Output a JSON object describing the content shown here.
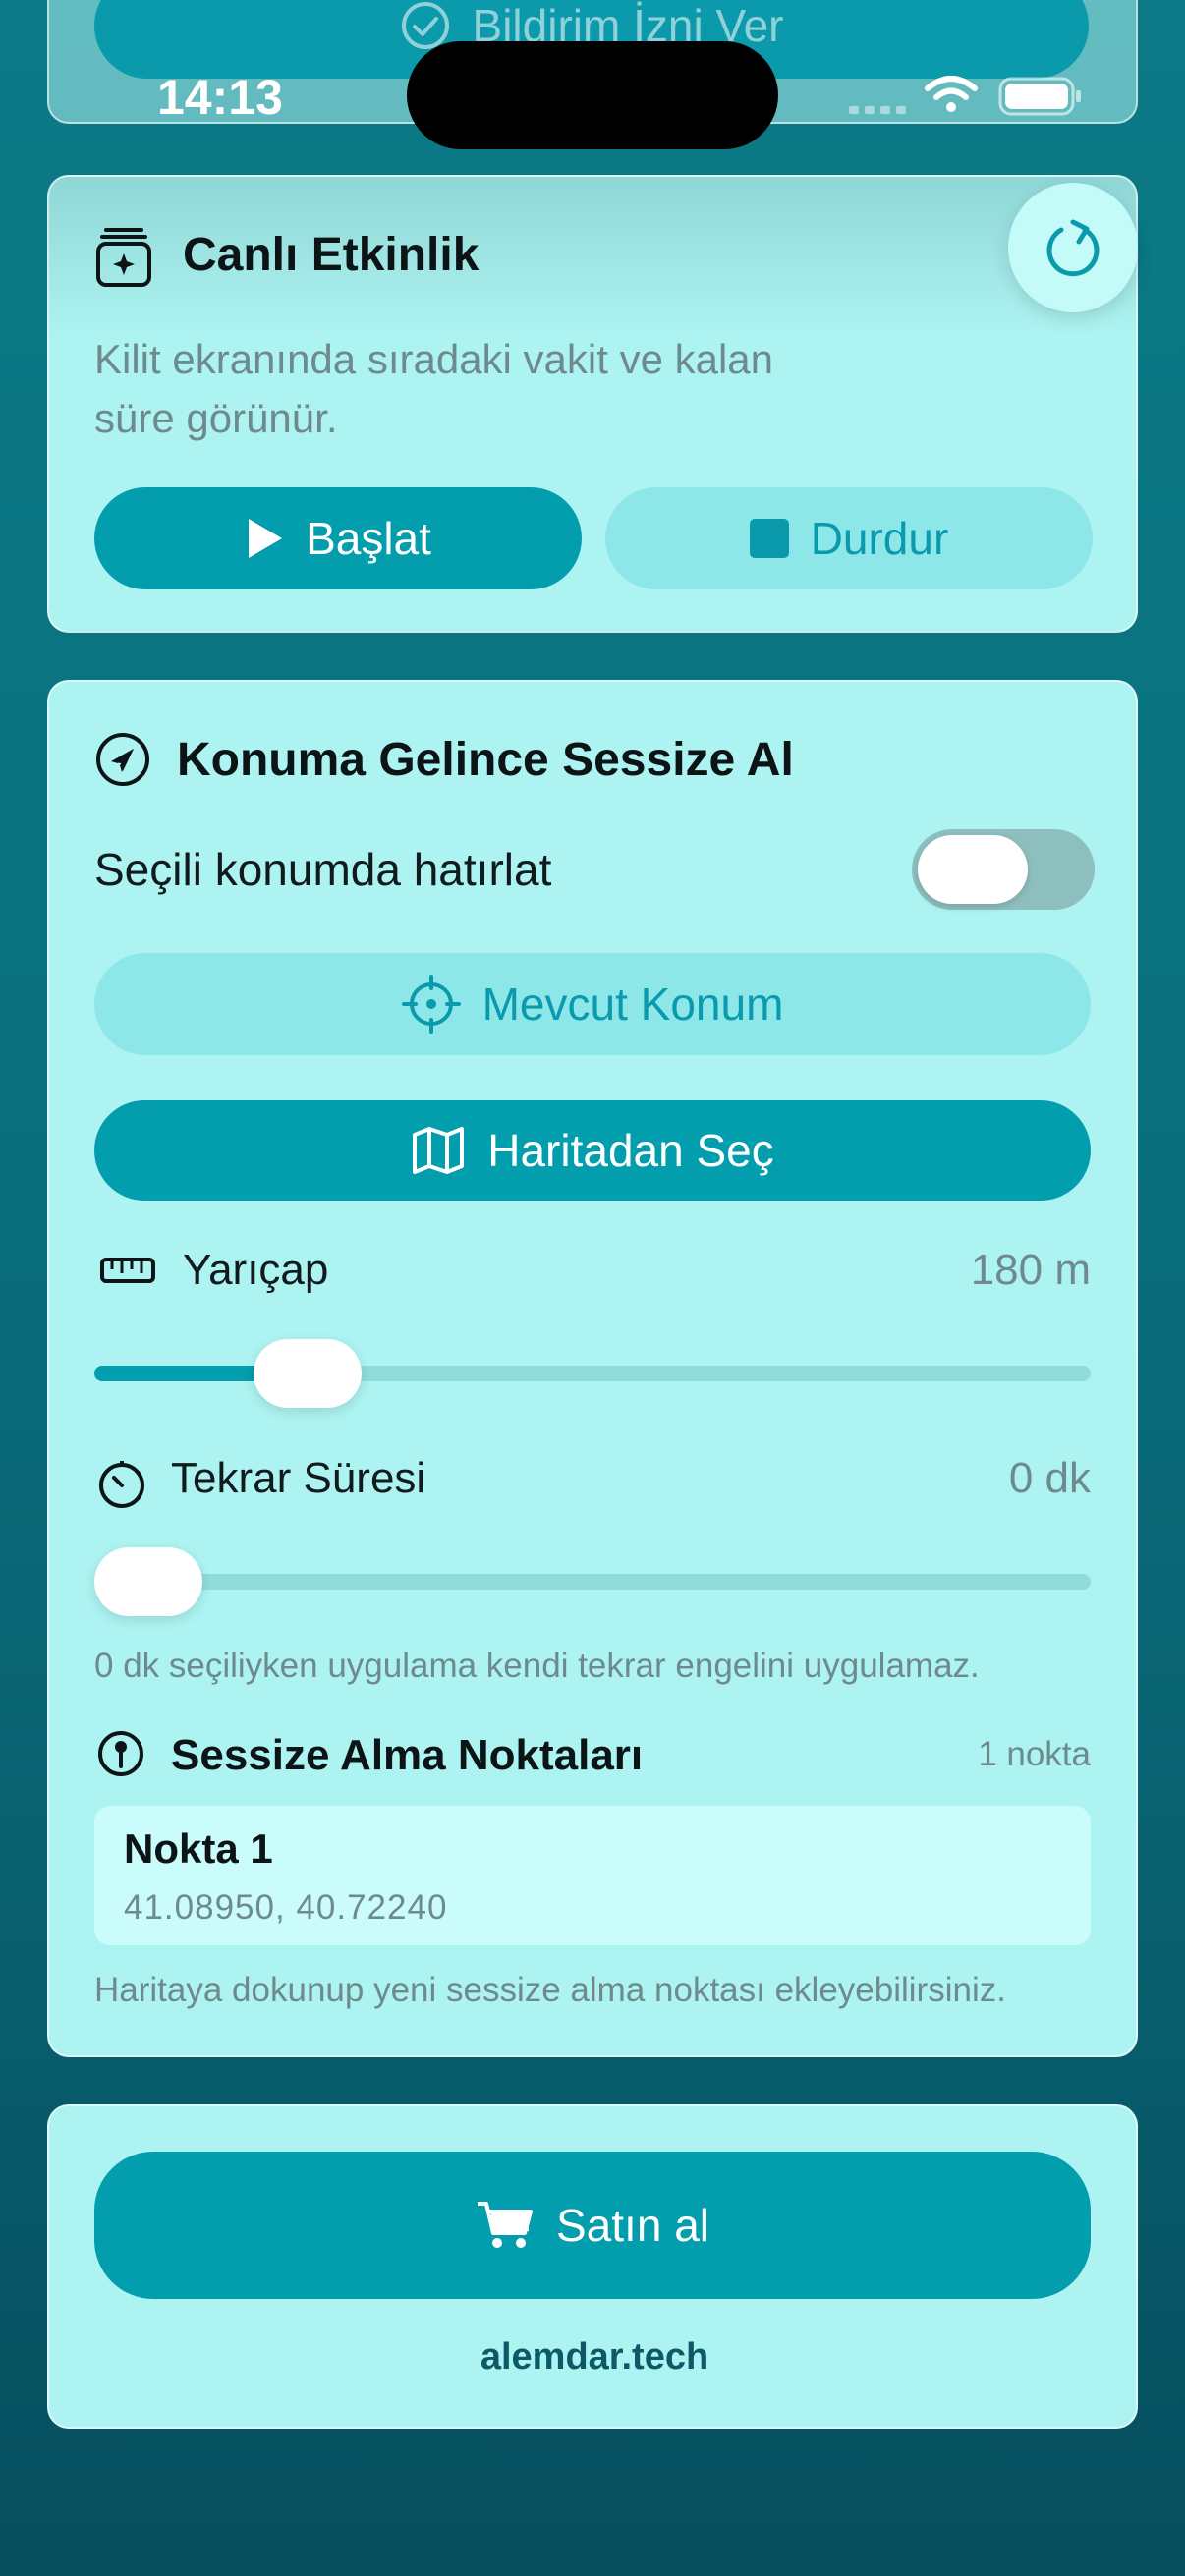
{
  "status_bar": {
    "time": "14:13"
  },
  "top_card": {
    "button_label": "Bildirim İzni Ver"
  },
  "live_activity": {
    "title": "Canlı Etkinlik",
    "description_line1": "Kilit ekranında sıradaki vakit ve kalan",
    "description_line2": "süre görünür.",
    "start_label": "Başlat",
    "stop_label": "Durdur"
  },
  "location_mute": {
    "title": "Konuma Gelince Sessize Al",
    "toggle_label": "Seçili konumda hatırlat",
    "toggle_on": false,
    "current_location_label": "Mevcut Konum",
    "pick_from_map_label": "Haritadan Seç",
    "radius_label": "Yarıçap",
    "radius_value": "180 m",
    "radius_fraction": 0.214,
    "repeat_label": "Tekrar Süresi",
    "repeat_value": "0 dk",
    "repeat_fraction": 0,
    "repeat_hint": "0 dk seçiliyken uygulama kendi tekrar engelini uygulamaz.",
    "points_title": "Sessize Alma Noktaları",
    "points_count": "1 nokta",
    "points": [
      {
        "name": "Nokta 1",
        "coords": "41.08950, 40.72240"
      }
    ],
    "map_hint": "Haritaya dokunup yeni sessize alma noktası ekleyebilirsiniz."
  },
  "purchase": {
    "buy_label": "Satın al",
    "site": "alemdar.tech"
  },
  "colors": {
    "accent": "#039eae",
    "card": "#adf3f1",
    "secondary": "#8de6e8"
  }
}
